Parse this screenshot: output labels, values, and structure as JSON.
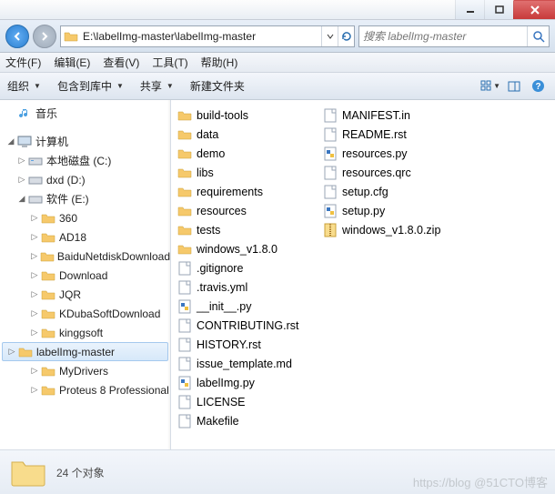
{
  "titlebar": {},
  "nav": {
    "path": "E:\\labelImg-master\\labelImg-master",
    "search_placeholder": "搜索 labelImg-master"
  },
  "menu": {
    "file": "文件(F)",
    "edit": "编辑(E)",
    "view": "查看(V)",
    "tools": "工具(T)",
    "help": "帮助(H)"
  },
  "toolbar": {
    "organize": "组织",
    "include": "包含到库中",
    "share": "共享",
    "newfolder": "新建文件夹"
  },
  "tree": {
    "music": "音乐",
    "computer": "计算机",
    "drive_c": "本地磁盘 (C:)",
    "drive_d": "dxd (D:)",
    "drive_e": "软件 (E:)",
    "folders": [
      "360",
      "AD18",
      "BaiduNetdiskDownload",
      "Download",
      "JQR",
      "KDubaSoftDownload",
      "kinggsoft",
      "labelImg-master",
      "MyDrivers",
      "Proteus 8 Professional"
    ]
  },
  "files": {
    "col1": [
      {
        "name": "build-tools",
        "type": "folder"
      },
      {
        "name": "data",
        "type": "folder"
      },
      {
        "name": "demo",
        "type": "folder"
      },
      {
        "name": "libs",
        "type": "folder"
      },
      {
        "name": "requirements",
        "type": "folder"
      },
      {
        "name": "resources",
        "type": "folder"
      },
      {
        "name": "tests",
        "type": "folder"
      },
      {
        "name": "windows_v1.8.0",
        "type": "folder"
      },
      {
        "name": ".gitignore",
        "type": "file"
      },
      {
        "name": ".travis.yml",
        "type": "file"
      },
      {
        "name": "__init__.py",
        "type": "py"
      },
      {
        "name": "CONTRIBUTING.rst",
        "type": "file"
      },
      {
        "name": "HISTORY.rst",
        "type": "file"
      },
      {
        "name": "issue_template.md",
        "type": "file"
      },
      {
        "name": "labelImg.py",
        "type": "py"
      },
      {
        "name": "LICENSE",
        "type": "file"
      },
      {
        "name": "Makefile",
        "type": "file"
      }
    ],
    "col2": [
      {
        "name": "MANIFEST.in",
        "type": "file"
      },
      {
        "name": "README.rst",
        "type": "file"
      },
      {
        "name": "resources.py",
        "type": "py"
      },
      {
        "name": "resources.qrc",
        "type": "file"
      },
      {
        "name": "setup.cfg",
        "type": "file"
      },
      {
        "name": "setup.py",
        "type": "py"
      },
      {
        "name": "windows_v1.8.0.zip",
        "type": "zip"
      }
    ]
  },
  "status": {
    "count_text": "24 个对象"
  },
  "watermark": "https://blog @51CTO博客"
}
